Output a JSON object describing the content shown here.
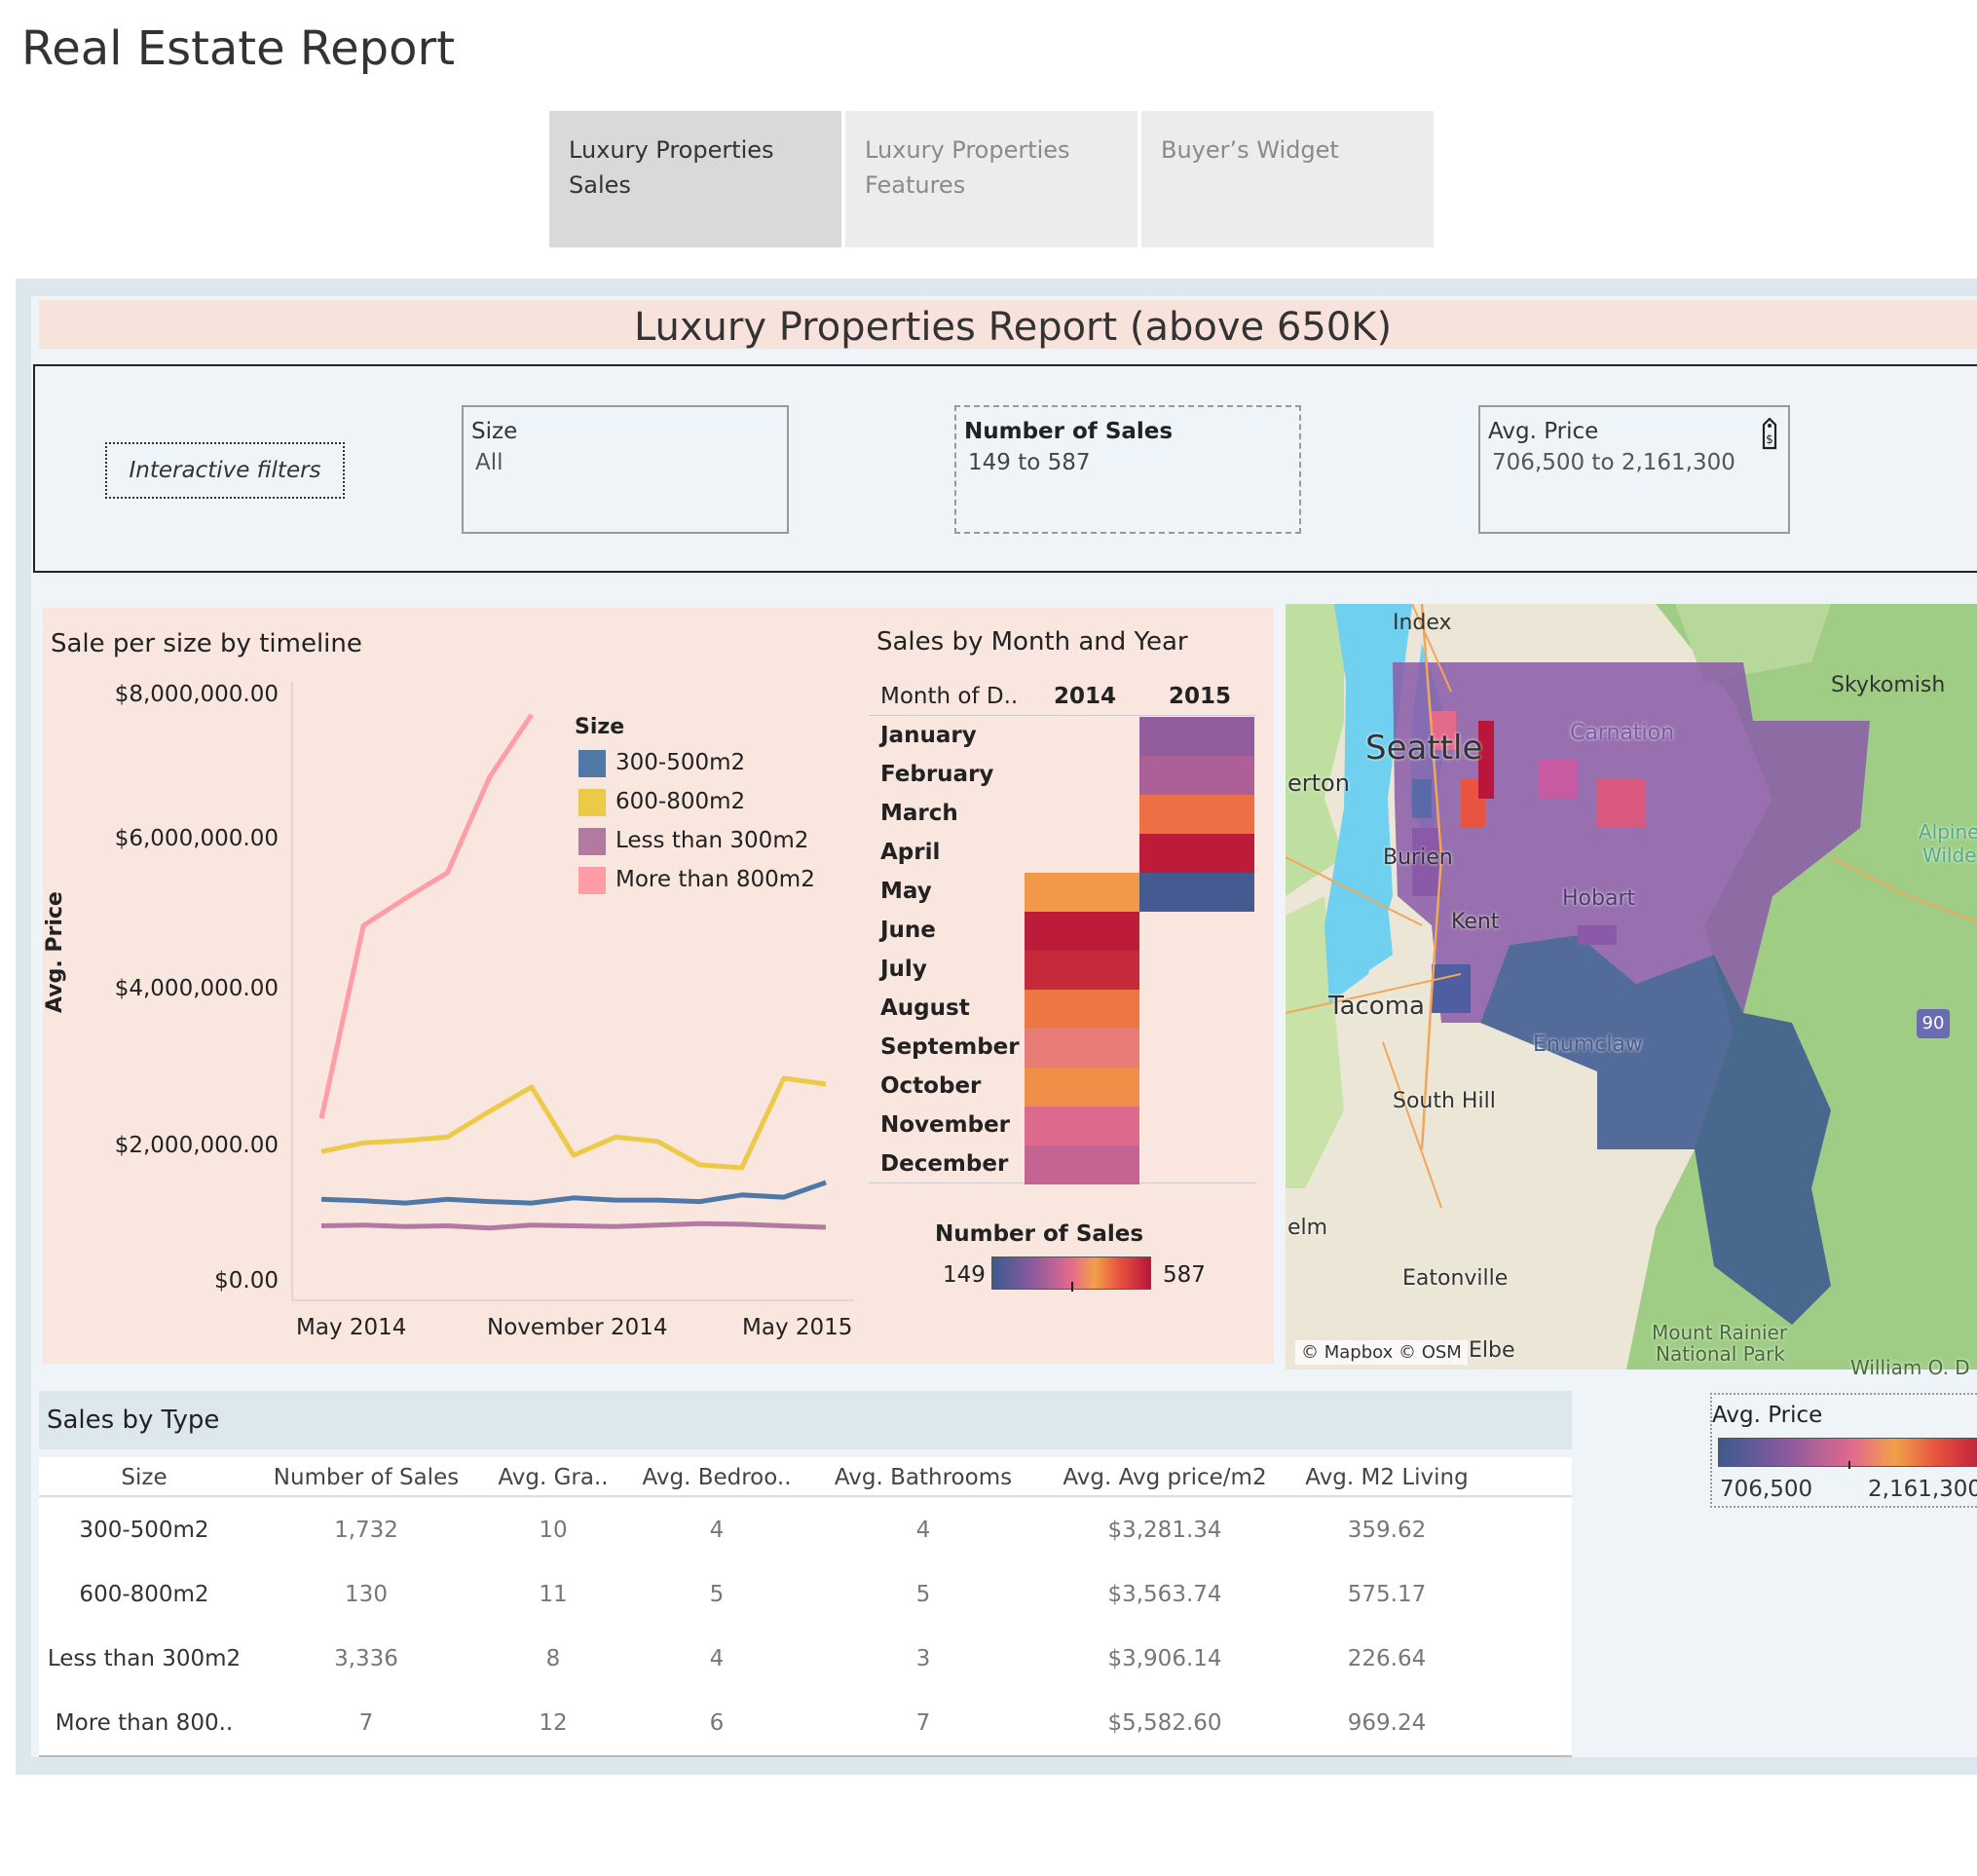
{
  "app": {
    "title": "Real Estate Report"
  },
  "tabs": [
    {
      "label_line1": "Luxury Properties",
      "label_line2": "Sales"
    },
    {
      "label_line1": "Luxury Properties",
      "label_line2": "Features"
    },
    {
      "label_line1": "Buyer’s Widget",
      "label_line2": ""
    }
  ],
  "report": {
    "title": "Luxury Properties Report (above 650K)"
  },
  "filters": {
    "interactive_label": "Interactive filters",
    "size": {
      "label": "Size",
      "value": "All"
    },
    "number_of_sales": {
      "label": "Number of Sales",
      "value": "149 to 587"
    },
    "avg_price": {
      "label": "Avg. Price",
      "value": "706,500 to 2,161,300",
      "icon": "price-tag-icon"
    }
  },
  "line_chart": {
    "title": "Sale per size by timeline",
    "ylabel": "Avg. Price",
    "yticks": [
      "$8,000,000.00",
      "$6,000,000.00",
      "$4,000,000.00",
      "$2,000,000.00",
      "$0.00"
    ],
    "xticks": [
      "May 2014",
      "November 2014",
      "May 2015"
    ],
    "legend_title": "Size"
  },
  "chart_data": [
    {
      "type": "line",
      "title": "Sale per size by timeline",
      "ylabel": "Avg. Price",
      "ylim": [
        0,
        8000000
      ],
      "x": [
        "May 2014",
        "Jun 2014",
        "Jul 2014",
        "Aug 2014",
        "Sep 2014",
        "Oct 2014",
        "Nov 2014",
        "Dec 2014",
        "Jan 2015",
        "Feb 2015",
        "Mar 2015",
        "Apr 2015",
        "May 2015"
      ],
      "series": [
        {
          "name": "300-500m2",
          "color": "#4e79a7",
          "values": [
            1150000,
            1130000,
            1100000,
            1150000,
            1120000,
            1100000,
            1170000,
            1140000,
            1140000,
            1120000,
            1210000,
            1180000,
            1380000
          ]
        },
        {
          "name": "600-800m2",
          "color": "#edc948",
          "values": [
            1800000,
            1920000,
            1950000,
            2000000,
            2350000,
            2680000,
            1750000,
            2000000,
            1940000,
            1620000,
            1580000,
            2800000,
            2720000
          ]
        },
        {
          "name": "Less than 300m2",
          "color": "#b07aa1",
          "values": [
            790000,
            800000,
            780000,
            790000,
            760000,
            800000,
            790000,
            780000,
            800000,
            820000,
            810000,
            790000,
            770000
          ]
        },
        {
          "name": "More than 800m2",
          "color": "#ff9da7",
          "values": [
            2250000,
            4880000,
            5250000,
            5600000,
            6900000,
            7750000,
            null,
            null,
            null,
            null,
            null,
            null,
            null
          ]
        }
      ]
    },
    {
      "type": "heatmap",
      "title": "Sales by Month and Year",
      "row_header": "Month of D..",
      "columns": [
        "2014",
        "2015"
      ],
      "rows": [
        "January",
        "February",
        "March",
        "April",
        "May",
        "June",
        "July",
        "August",
        "September",
        "October",
        "November",
        "December"
      ],
      "values": [
        [
          null,
          270
        ],
        [
          null,
          300
        ],
        [
          null,
          475
        ],
        [
          null,
          580
        ],
        [
          440,
          160
        ],
        [
          580,
          null
        ],
        [
          560,
          null
        ],
        [
          470,
          null
        ],
        [
          390,
          null
        ],
        [
          450,
          null
        ],
        [
          360,
          null
        ],
        [
          330,
          null
        ]
      ],
      "color_legend": {
        "title": "Number of Sales",
        "min": 149,
        "max": 587
      }
    },
    {
      "type": "table",
      "title": "Sales by Type",
      "columns": [
        "Size",
        "Number of Sales",
        "Avg. Gra..",
        "Avg. Bedroo..",
        "Avg. Bathrooms",
        "Avg. Avg price/m2",
        "Avg. M2 Living"
      ],
      "rows": [
        [
          "300-500m2",
          "1,732",
          "10",
          "4",
          "4",
          "$3,281.34",
          "359.62"
        ],
        [
          "600-800m2",
          "130",
          "11",
          "5",
          "5",
          "$3,563.74",
          "575.17"
        ],
        [
          "Less than 300m2",
          "3,336",
          "8",
          "4",
          "3",
          "$3,906.14",
          "226.64"
        ],
        [
          "More than 800..",
          "7",
          "12",
          "6",
          "7",
          "$5,582.60",
          "969.24"
        ]
      ]
    }
  ],
  "heatmap": {
    "title": "Sales by Month and Year",
    "row_header": "Month of D..",
    "col_2014": "2014",
    "col_2015": "2015",
    "legend_title": "Number of Sales",
    "legend_min": "149",
    "legend_max": "587"
  },
  "map": {
    "labels": [
      "Index",
      "Skykomish",
      "Seattle",
      "erton",
      "Carnation",
      "Alpine",
      "Wilde",
      "Burien",
      "Hobart",
      "Kent",
      "Tacoma",
      "Enumclaw",
      "South Hill",
      "elm",
      "Eatonville",
      "Elbe",
      "Mount Rainier",
      "National Park",
      "William O. D"
    ],
    "highway": "90",
    "attribution": "© Mapbox © OSM"
  },
  "price_legend": {
    "title": "Avg. Price",
    "min": "706,500",
    "max": "2,161,300"
  },
  "table": {
    "title": "Sales by Type"
  },
  "colors": {
    "pink_panel": "#f8e6df",
    "dash_bg": "#dde8ee",
    "water": "#6fd0f0",
    "forest": "#9ccc82"
  }
}
